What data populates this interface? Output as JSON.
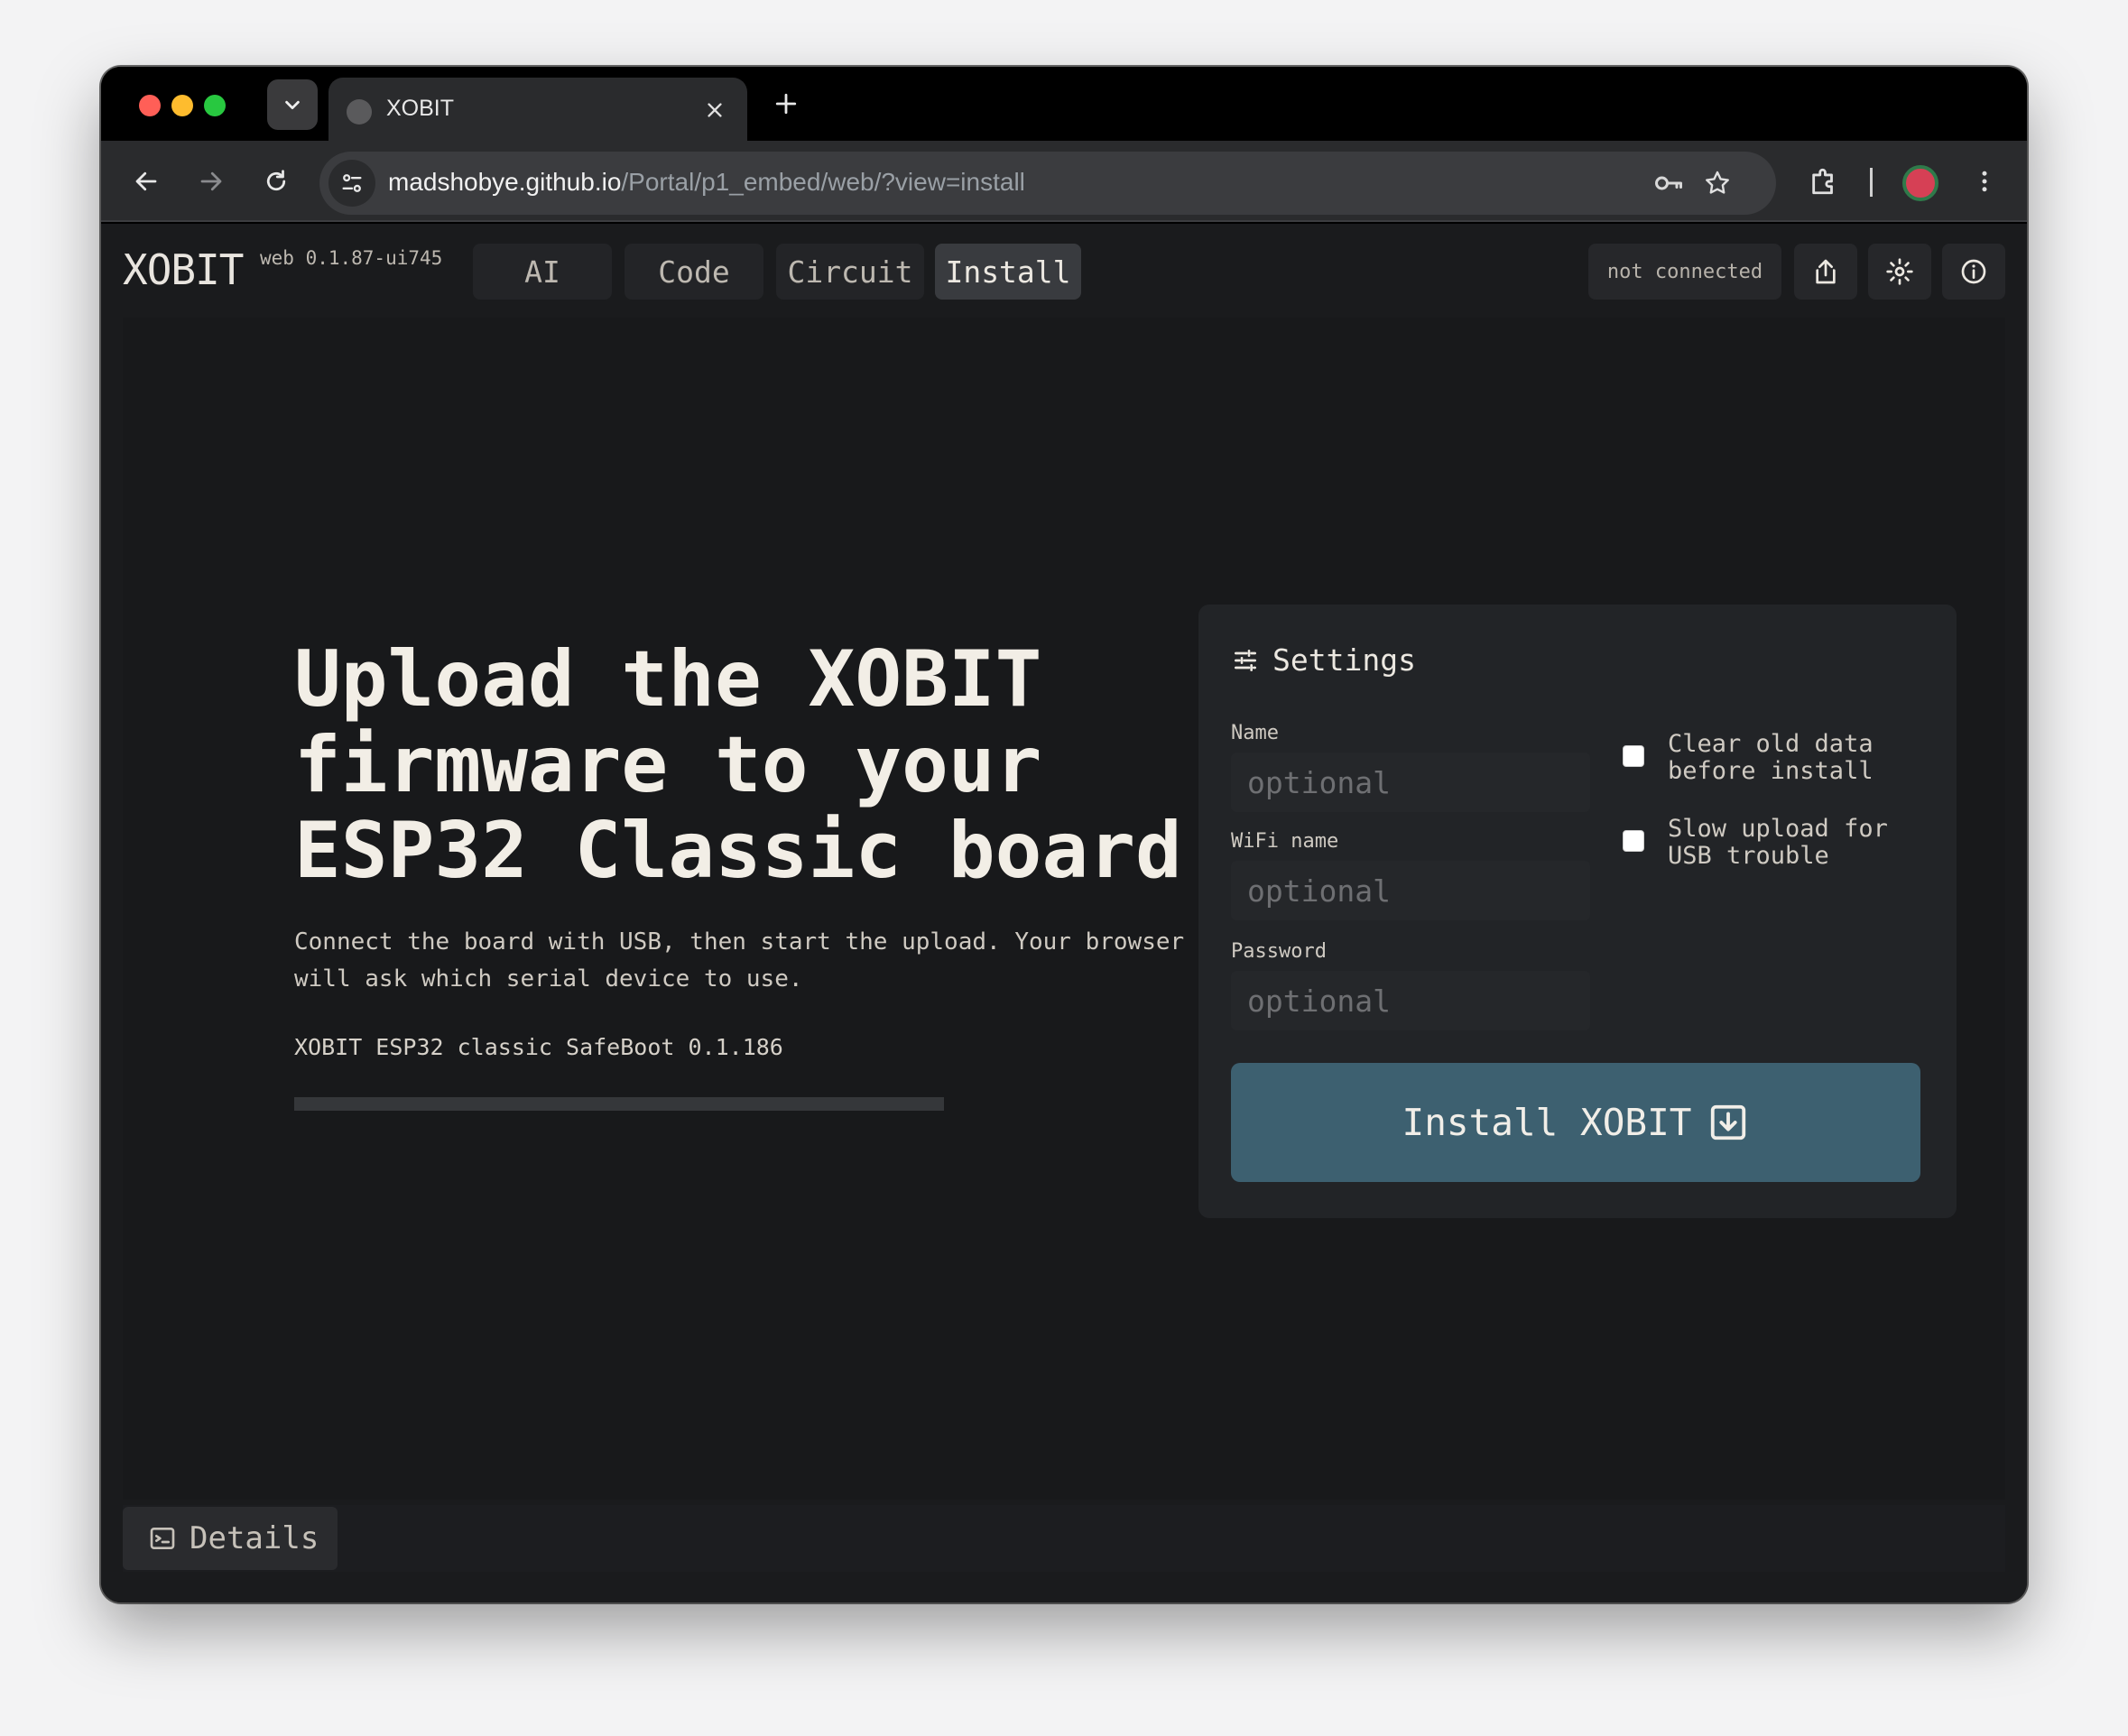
{
  "browser": {
    "tab_title": "XOBIT",
    "url_host": "madshobye.github.io",
    "url_path": "/Portal/p1_embed/web/?view=install"
  },
  "app": {
    "brand": "XOBIT",
    "version": "web 0.1.87-ui745",
    "tabs": [
      {
        "label": "AI",
        "active": false
      },
      {
        "label": "Code",
        "active": false
      },
      {
        "label": "Circuit",
        "active": false
      },
      {
        "label": "Install",
        "active": true
      }
    ],
    "connection_status": "not connected"
  },
  "hero": {
    "title": "Upload the XOBIT firmware to your ESP32 Classic board",
    "subtitle": "Connect the board with USB, then start the upload. Your browser will ask which serial device to use.",
    "firmware": "XOBIT ESP32 classic SafeBoot 0.1.186",
    "progress": 0
  },
  "settings": {
    "title": "Settings",
    "fields": [
      {
        "label": "Name",
        "placeholder": "optional"
      },
      {
        "label": "WiFi name",
        "placeholder": "optional"
      },
      {
        "label": "Password",
        "placeholder": "optional"
      }
    ],
    "options": [
      {
        "label": "Clear old data before install",
        "checked": false
      },
      {
        "label": "Slow upload for USB trouble",
        "checked": false
      }
    ],
    "install_label": "Install XOBIT"
  },
  "footer": {
    "details_label": "Details"
  },
  "colors": {
    "accent": "#3d6070",
    "background": "#18191b",
    "text": "#f2eee6"
  }
}
